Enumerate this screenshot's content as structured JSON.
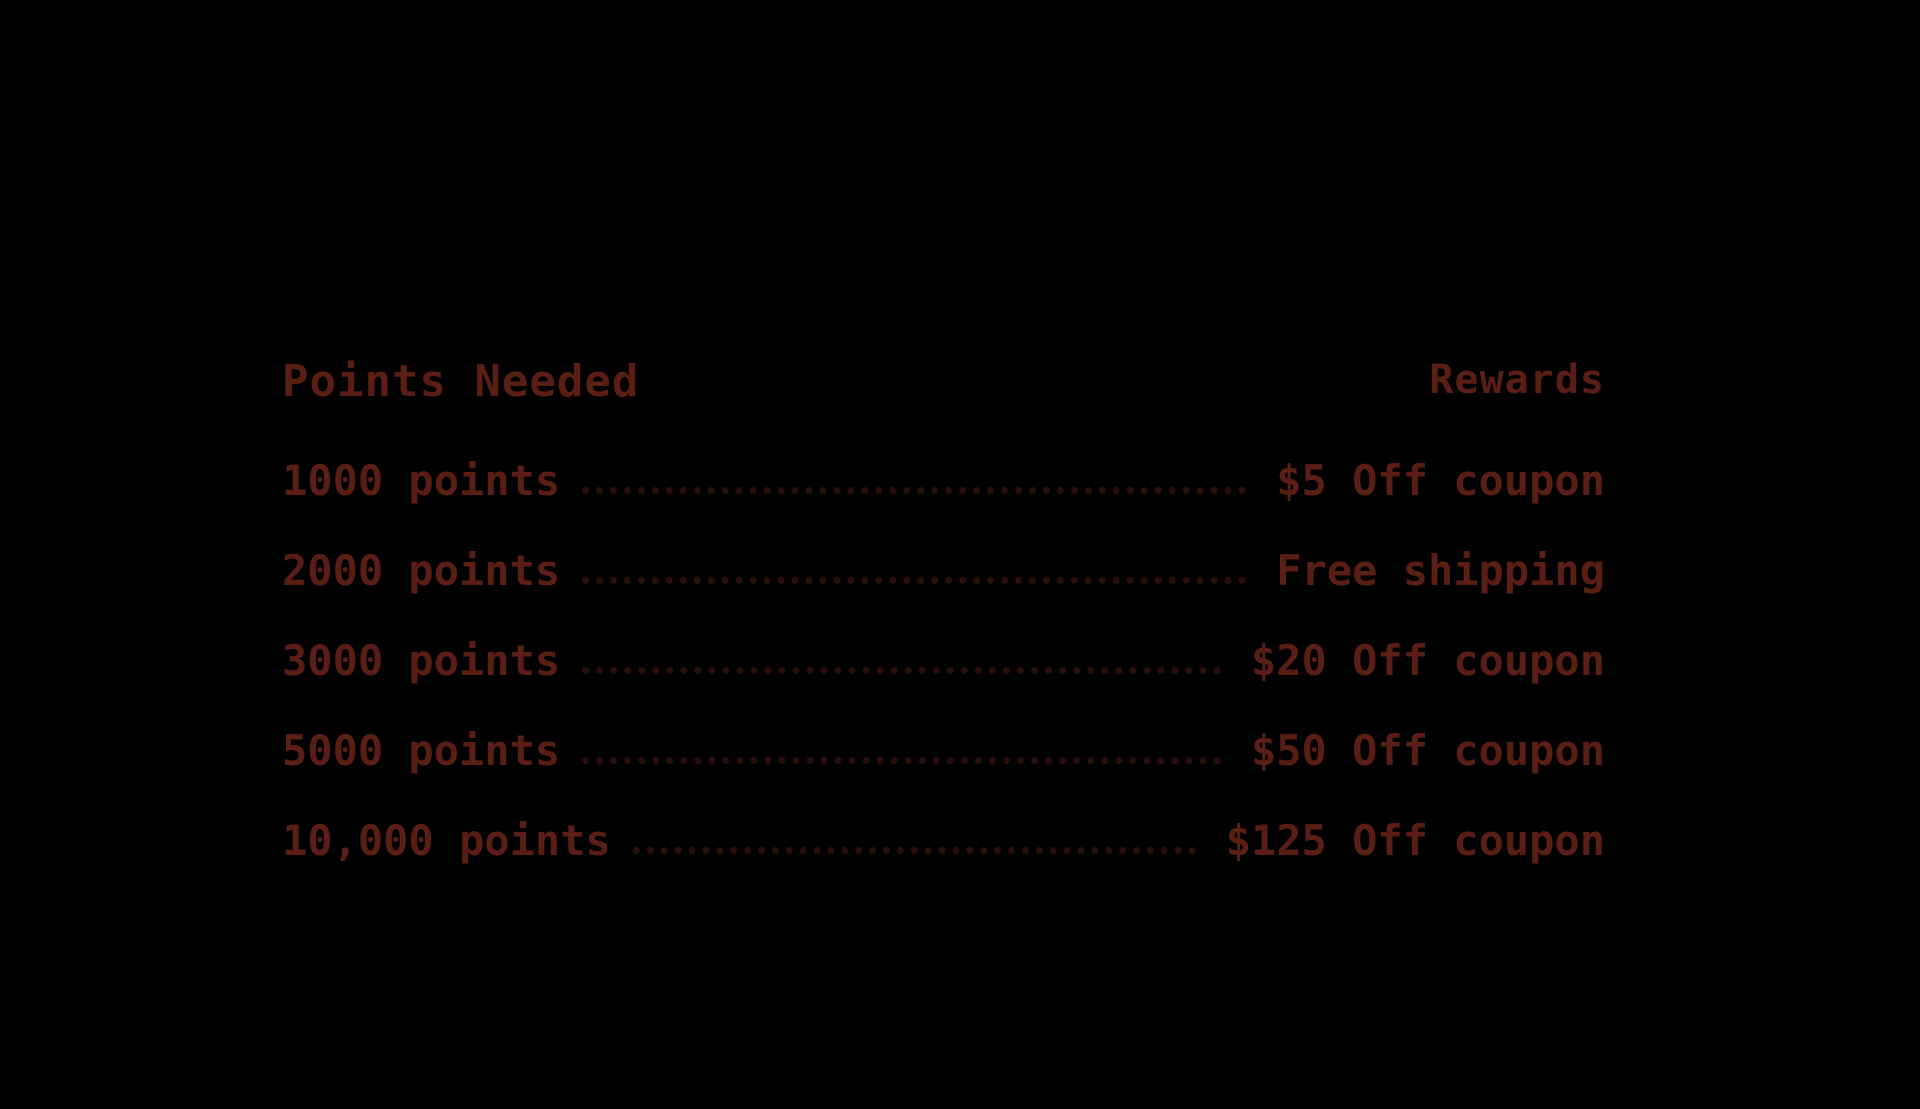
{
  "table": {
    "header": {
      "points_label": "Points Needed",
      "rewards_label": "Rewards"
    },
    "rows": [
      {
        "points": "1000 points",
        "reward": "$5 Off coupon"
      },
      {
        "points": "2000 points",
        "reward": "Free shipping"
      },
      {
        "points": "3000 points",
        "reward": "$20 Off coupon"
      },
      {
        "points": "5000 points",
        "reward": "$50 Off coupon"
      },
      {
        "points": "10,000 points",
        "reward": "$125 Off coupon"
      }
    ]
  },
  "colors": {
    "background": "#000000",
    "text": "#5a1e14",
    "leader": "#2a0e0a"
  }
}
